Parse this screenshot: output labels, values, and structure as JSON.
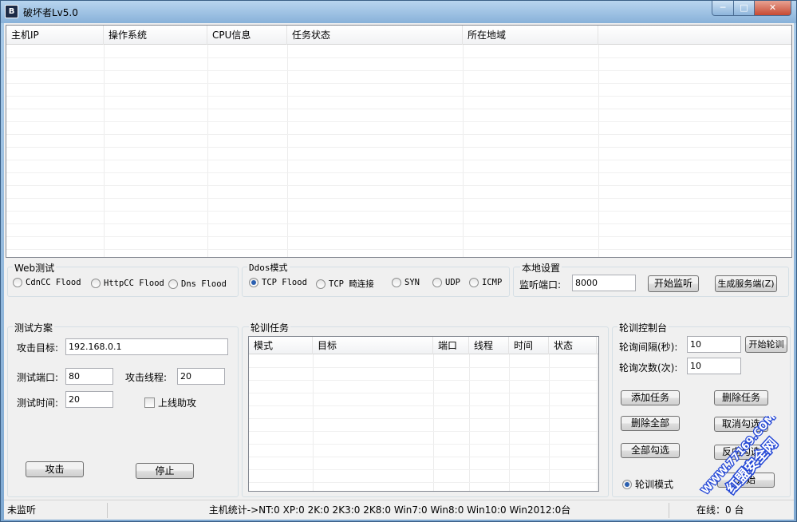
{
  "window": {
    "title": "破坏者Lv5.0",
    "app_icon_glyph": "B",
    "minimize": "─",
    "maximize": "□",
    "close": "✕"
  },
  "hostlist": {
    "columns": [
      "主机IP",
      "操作系统",
      "CPU信息",
      "任务状态",
      "所在地域",
      ""
    ]
  },
  "web_test": {
    "label": "Web测试",
    "options": [
      "CdnCC Flood",
      "HttpCC Flood",
      "Dns Flood"
    ]
  },
  "ddos": {
    "label": "Ddos模式",
    "options": [
      "TCP Flood",
      "TCP 畸连接",
      "SYN",
      "UDP",
      "ICMP"
    ],
    "selected": "TCP Flood"
  },
  "local": {
    "label": "本地设置",
    "port_label": "监听端口:",
    "port_value": "8000",
    "start_listen": "开始监听",
    "gen_server": "生成服务端(Z)"
  },
  "plan": {
    "label": "测试方案",
    "target_label": "攻击目标:",
    "target_value": "192.168.0.1",
    "port_label": "测试端口:",
    "port_value": "80",
    "threads_label": "攻击线程:",
    "threads_value": "20",
    "time_label": "测试时间:",
    "time_value": "20",
    "assist_label": "上线助攻",
    "attack_button": "攻击",
    "stop_button": "停止"
  },
  "rotation": {
    "label": "轮训任务",
    "columns": [
      "模式",
      "目标",
      "端口",
      "线程",
      "时间",
      "状态"
    ]
  },
  "console": {
    "label": "轮训控制台",
    "interval_label": "轮询间隔(秒):",
    "interval_value": "10",
    "start_button": "开始轮训",
    "count_label": "轮询次数(次):",
    "count_value": "10",
    "add_task": "添加任务",
    "delete_task": "删除任务",
    "delete_all": "删除全部",
    "uncheck": "取消勾选",
    "check_all": "全部勾选",
    "invert": "反向勾选",
    "mode_label": "轮训模式",
    "bottom_button": "开始"
  },
  "statusbar": {
    "state": "未监听",
    "stats": "主机统计->NT:0  XP:0  2K:0  2K3:0  2K8:0  Win7:0  Win8:0 Win10:0 Win2012:0台",
    "online": "在线：0 台"
  },
  "watermark": {
    "text": "红盟安全网",
    "url": "WWW.77169.COM"
  },
  "colors": {
    "titlebar": "#88b1d9",
    "close": "#c74a33",
    "radio_selected": "#2a5fb0",
    "watermark": "#2548d6"
  }
}
